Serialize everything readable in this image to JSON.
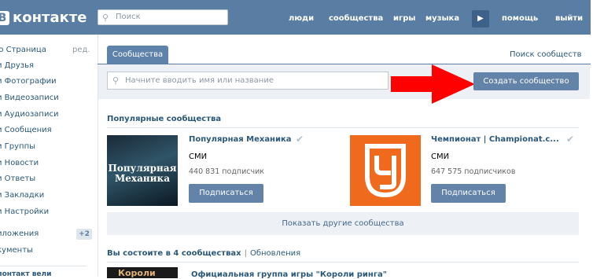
{
  "header": {
    "logo_text": "контакте",
    "search_placeholder": "Поиск",
    "nav": [
      "люди",
      "сообщества",
      "игры",
      "музыка",
      "помощь",
      "выйти"
    ]
  },
  "sidebar": {
    "items": [
      "ю Страница",
      "и Друзья",
      "и Фотографии",
      "и Видеозаписи",
      "и Аудиозаписи",
      "и Сообщения",
      "и Группы",
      "и Новости",
      "и Ответы",
      "и Закладки",
      "и Настройки",
      "иложения",
      "кументы"
    ],
    "edit_label": "ред.",
    "apps_badge": "+2",
    "truncated_bottom": "лонтакт вели"
  },
  "tabs": {
    "active": "Сообщества",
    "search_link": "Поиск сообществ"
  },
  "group_search": {
    "placeholder": "Начните вводить имя или название"
  },
  "create_button": "Создать сообщество",
  "popular": {
    "title": "Популярные сообщества",
    "cards": [
      {
        "name": "Популярная Механика",
        "category": "СМИ",
        "subscribers": "440 831 подписчик",
        "button": "Подписаться",
        "thumb_text_1": "Популярная",
        "thumb_text_2": "Механика"
      },
      {
        "name": "Чемпионат | Championat.c...",
        "category": "СМИ",
        "subscribers": "647 575 подписчиков",
        "button": "Подписаться"
      }
    ],
    "more_button": "Показать другие сообщества"
  },
  "member": {
    "count_text": "Вы состоите в 4 сообществах",
    "separator": "|",
    "updates_link": "Обновления"
  },
  "official": {
    "thumb_text": "Короли",
    "name": "Официальная группа игры \"Короли ринга\""
  },
  "colors": {
    "header": "#597da3",
    "accent": "#6383a8",
    "link": "#2b587a",
    "arrow": "#ff0000",
    "championat": "#f06a1d"
  }
}
